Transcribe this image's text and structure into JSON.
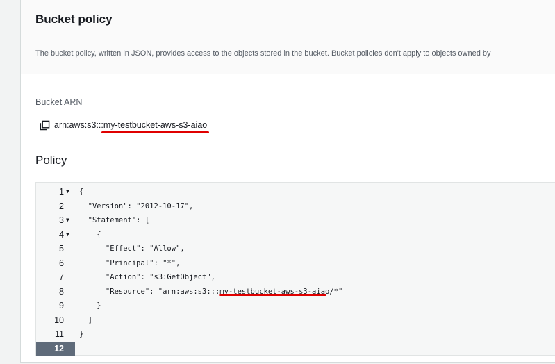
{
  "section": {
    "title": "Bucket policy",
    "description": "The bucket policy, written in JSON, provides access to the objects stored in the bucket. Bucket policies don't apply to objects owned by"
  },
  "arn": {
    "label": "Bucket ARN",
    "prefix": "arn:aws:s3:::",
    "bucket_name": "my-testbucket-aws-s3-aiao"
  },
  "policy": {
    "heading": "Policy",
    "active_line": 12,
    "lines": [
      {
        "num": "1",
        "fold": "▼",
        "text": "{"
      },
      {
        "num": "2",
        "fold": "",
        "text": "  \"Version\": \"2012-10-17\","
      },
      {
        "num": "3",
        "fold": "▼",
        "text": "  \"Statement\": ["
      },
      {
        "num": "4",
        "fold": "▼",
        "text": "    {"
      },
      {
        "num": "5",
        "fold": "",
        "text": "      \"Effect\": \"Allow\","
      },
      {
        "num": "6",
        "fold": "",
        "text": "      \"Principal\": \"*\","
      },
      {
        "num": "7",
        "fold": "",
        "text": "      \"Action\": \"s3:GetObject\","
      },
      {
        "num": "8",
        "fold": "",
        "text_prefix": "      \"Resource\": \"arn:aws:s3:::",
        "text_highlight": "my-testbucket-aws-s3-aiao",
        "text_suffix": "/*\""
      },
      {
        "num": "9",
        "fold": "",
        "text": "    }"
      },
      {
        "num": "10",
        "fold": "",
        "text": "  ]"
      },
      {
        "num": "11",
        "fold": "",
        "text": "}"
      },
      {
        "num": "12",
        "fold": "",
        "text": ""
      }
    ]
  },
  "colors": {
    "annotation_red": "#e00000",
    "active_gutter": "#5f6b7a",
    "editor_bg": "#f6f7f7"
  }
}
